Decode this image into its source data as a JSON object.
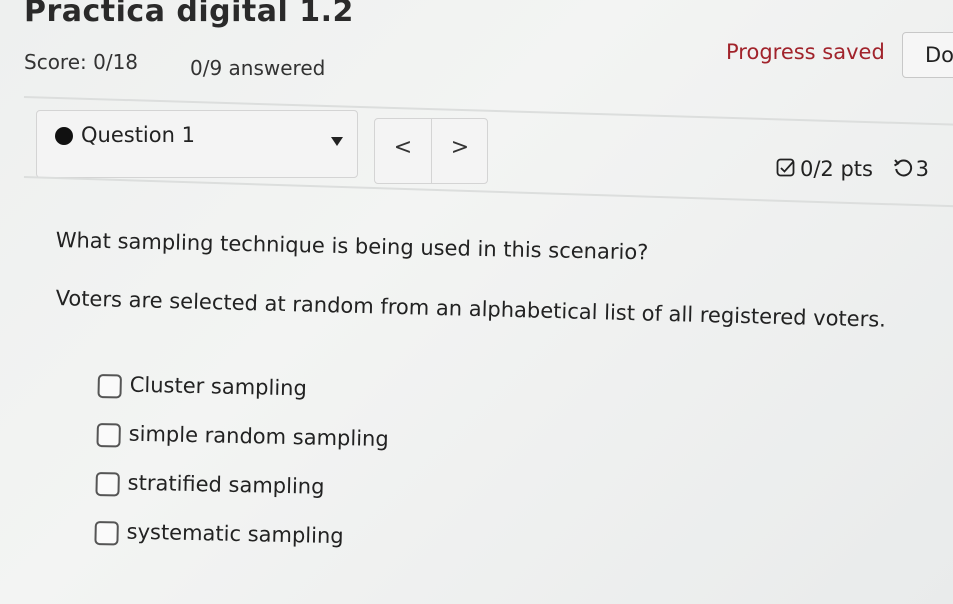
{
  "header": {
    "title": "Practica digital 1.2",
    "score": "Score: 0/18",
    "answered": "0/9 answered",
    "progress_status": "Progress saved",
    "done_label": "Do"
  },
  "question_nav": {
    "selected": "Question 1",
    "prev_label": "<",
    "next_label": ">"
  },
  "points": {
    "value": "0/2 pts",
    "retries": "3"
  },
  "question": {
    "prompt": "What sampling technique is being used in this scenario?",
    "scenario": "Voters are selected at random from an alphabetical list of all registered voters.",
    "options": [
      "Cluster sampling",
      "simple random sampling",
      "stratified sampling",
      "systematic sampling"
    ]
  },
  "colors": {
    "progress_saved": "#a1232b",
    "background": "#eef0ef"
  },
  "icons": {
    "question_marker": "status-dot-icon",
    "dropdown": "caret-down-icon",
    "points": "checkbox-icon",
    "retry": "retry-icon"
  }
}
